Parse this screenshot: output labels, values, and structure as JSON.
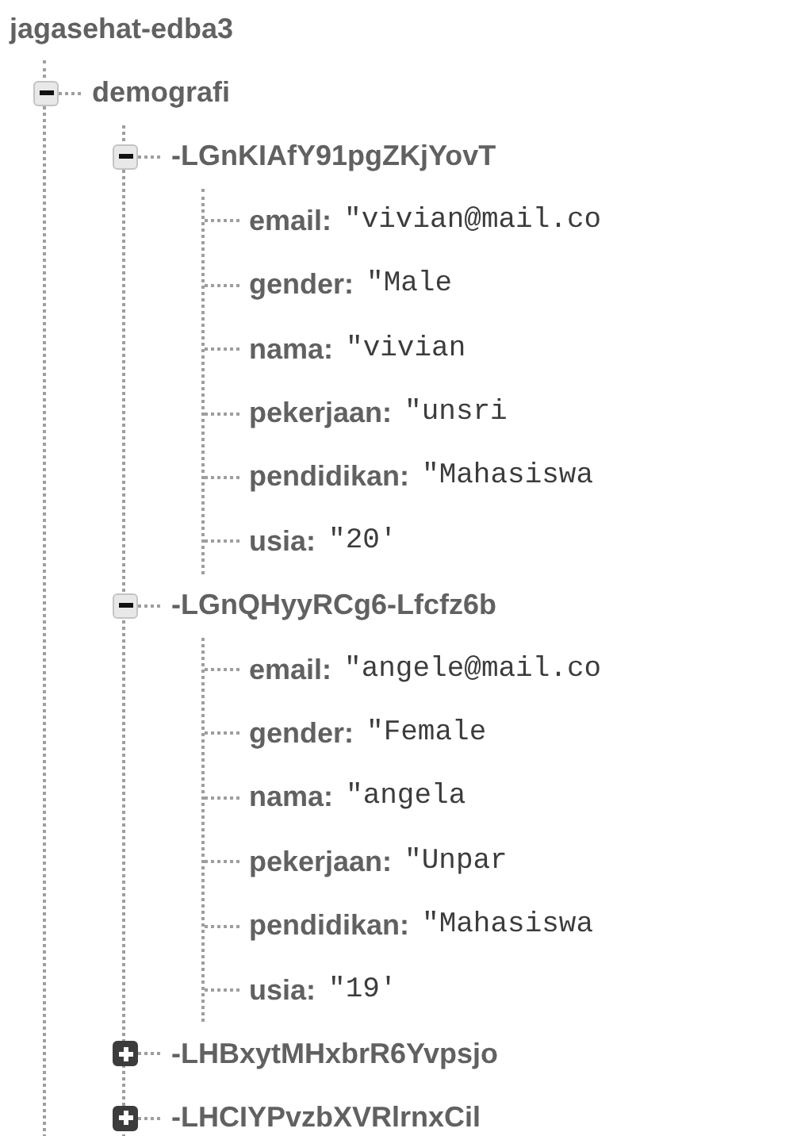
{
  "database": {
    "name": "jagasehat-edba3",
    "children": [
      {
        "kind": "node",
        "label": "demografi",
        "expanded": true,
        "children": [
          {
            "kind": "node",
            "label": "-LGnKIAfY91pgZKjYovT",
            "expanded": true,
            "children": [
              {
                "kind": "field",
                "key": "email:",
                "value": "\"vivian@mail.co"
              },
              {
                "kind": "field",
                "key": "gender:",
                "value": "\"Male"
              },
              {
                "kind": "field",
                "key": "nama:",
                "value": "\"vivian"
              },
              {
                "kind": "field",
                "key": "pekerjaan:",
                "value": "\"unsri"
              },
              {
                "kind": "field",
                "key": "pendidikan:",
                "value": "\"Mahasiswa"
              },
              {
                "kind": "field",
                "key": "usia:",
                "value": "\"20'"
              }
            ]
          },
          {
            "kind": "node",
            "label": "-LGnQHyyRCg6-Lfcfz6b",
            "expanded": true,
            "children": [
              {
                "kind": "field",
                "key": "email:",
                "value": "\"angele@mail.co"
              },
              {
                "kind": "field",
                "key": "gender:",
                "value": "\"Female"
              },
              {
                "kind": "field",
                "key": "nama:",
                "value": "\"angela"
              },
              {
                "kind": "field",
                "key": "pekerjaan:",
                "value": "\"Unpar"
              },
              {
                "kind": "field",
                "key": "pendidikan:",
                "value": "\"Mahasiswa"
              },
              {
                "kind": "field",
                "key": "usia:",
                "value": "\"19'"
              }
            ]
          },
          {
            "kind": "node",
            "label": "-LHBxytMHxbrR6Yvpsjo",
            "expanded": false
          },
          {
            "kind": "node",
            "label": "-LHCIYPvzbXVRlrnxCil",
            "expanded": false
          }
        ]
      }
    ]
  }
}
